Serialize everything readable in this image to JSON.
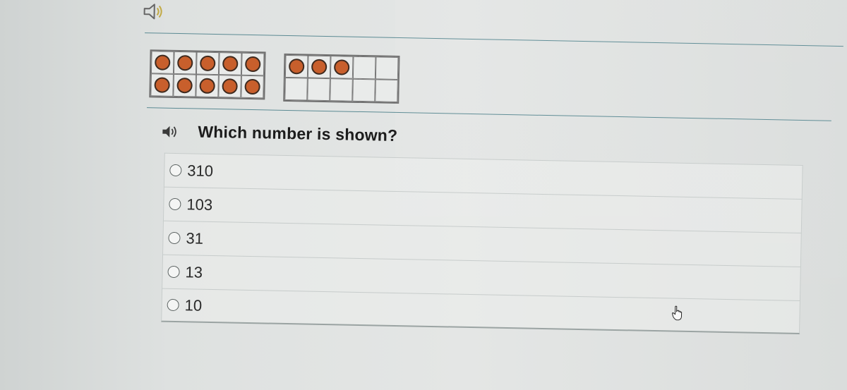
{
  "top_audio": {
    "icon": "speaker-icon"
  },
  "ten_frames": [
    {
      "filled": [
        true,
        true,
        true,
        true,
        true,
        true,
        true,
        true,
        true,
        true
      ]
    },
    {
      "filled": [
        true,
        true,
        true,
        false,
        false,
        false,
        false,
        false,
        false,
        false
      ]
    }
  ],
  "question": {
    "icon": "speaker-icon",
    "text": "Which number is shown?"
  },
  "options": [
    {
      "label": "310"
    },
    {
      "label": "103"
    },
    {
      "label": "31"
    },
    {
      "label": "13"
    },
    {
      "label": "10"
    }
  ],
  "colors": {
    "counter": "#c85f2c",
    "rule": "#5b8a93"
  }
}
